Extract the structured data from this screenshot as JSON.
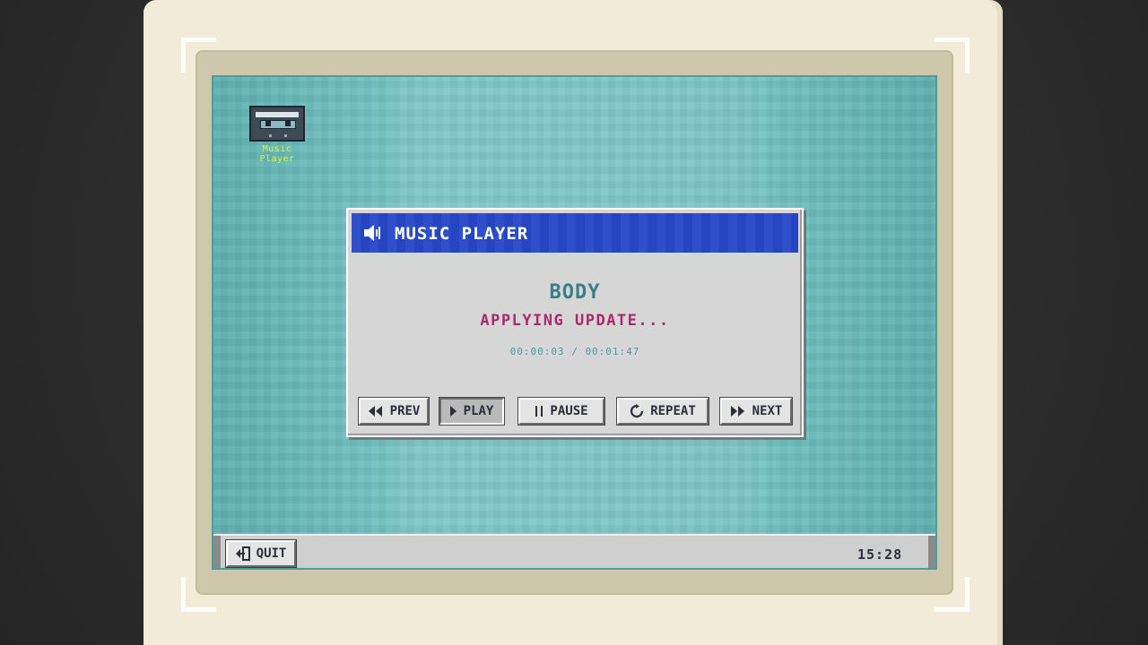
{
  "desktop": {
    "icons": [
      {
        "label_line1": "Music",
        "label_line2": "Player",
        "icon": "cassette-icon"
      }
    ]
  },
  "window": {
    "title": "MUSIC PLAYER",
    "title_icon": "speaker-icon",
    "track_title": "BODY",
    "status": "APPLYING UPDATE...",
    "time_elapsed": "00:00:03",
    "time_separator": "/",
    "time_total": "00:01:47",
    "colors": {
      "titlebar": "#2848c8",
      "track": "#3a7f84",
      "status": "#a82a6a"
    }
  },
  "controls": {
    "prev": {
      "label": "PREV",
      "icon": "rewind-icon"
    },
    "play": {
      "label": "PLAY",
      "icon": "play-icon",
      "pressed": true
    },
    "pause": {
      "label": "PAUSE",
      "icon": "pause-icon"
    },
    "repeat": {
      "label": "REPEAT",
      "icon": "repeat-icon"
    },
    "next": {
      "label": "NEXT",
      "icon": "fast-forward-icon"
    }
  },
  "taskbar": {
    "quit_label": "QUIT",
    "quit_icon": "exit-icon",
    "clock": "15:28"
  }
}
